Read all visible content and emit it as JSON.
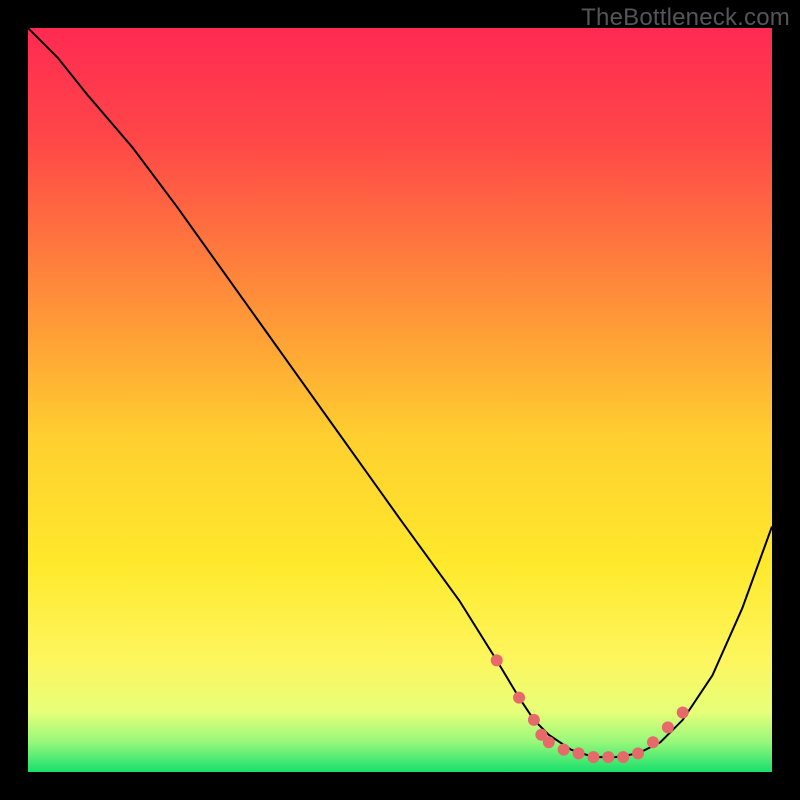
{
  "watermark": "TheBottleneck.com",
  "chart_data": {
    "type": "line",
    "title": "",
    "xlabel": "",
    "ylabel": "",
    "xlim": [
      0,
      100
    ],
    "ylim": [
      0,
      100
    ],
    "grid": false,
    "legend": false,
    "gradient_stops": [
      {
        "offset": 0.0,
        "color": "#ff2a52"
      },
      {
        "offset": 0.15,
        "color": "#ff4748"
      },
      {
        "offset": 0.35,
        "color": "#ff8a3a"
      },
      {
        "offset": 0.55,
        "color": "#ffcf2f"
      },
      {
        "offset": 0.72,
        "color": "#ffe92c"
      },
      {
        "offset": 0.85,
        "color": "#fdf65e"
      },
      {
        "offset": 0.92,
        "color": "#e6ff79"
      },
      {
        "offset": 0.96,
        "color": "#96f87a"
      },
      {
        "offset": 1.0,
        "color": "#17e06d"
      }
    ],
    "series": [
      {
        "name": "bottleneck-curve",
        "stroke": "#000000",
        "stroke_width": 2.0,
        "x": [
          0,
          4,
          8,
          14,
          20,
          30,
          40,
          50,
          58,
          63,
          66,
          68,
          70,
          73,
          76,
          79,
          82,
          85,
          88,
          92,
          96,
          100
        ],
        "y": [
          100,
          96,
          91,
          84,
          76,
          62,
          48,
          34,
          23,
          15,
          10,
          7,
          5,
          3,
          2,
          2,
          2.5,
          4,
          7,
          13,
          22,
          33
        ]
      }
    ],
    "markers": {
      "name": "sweet-spot",
      "color": "#e76a6a",
      "radius": 6,
      "points": [
        {
          "x": 63,
          "y": 15
        },
        {
          "x": 66,
          "y": 10
        },
        {
          "x": 68,
          "y": 7
        },
        {
          "x": 69,
          "y": 5
        },
        {
          "x": 70,
          "y": 4
        },
        {
          "x": 72,
          "y": 3
        },
        {
          "x": 74,
          "y": 2.5
        },
        {
          "x": 76,
          "y": 2
        },
        {
          "x": 78,
          "y": 2
        },
        {
          "x": 80,
          "y": 2
        },
        {
          "x": 82,
          "y": 2.5
        },
        {
          "x": 84,
          "y": 4
        },
        {
          "x": 86,
          "y": 6
        },
        {
          "x": 88,
          "y": 8
        }
      ]
    }
  }
}
